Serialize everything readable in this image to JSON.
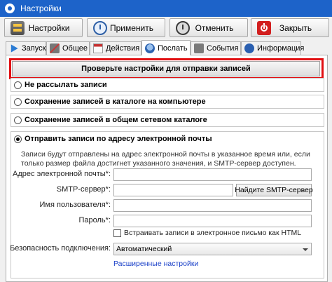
{
  "window": {
    "title": "Настройки"
  },
  "toolbar": {
    "settings_label": "Настройки",
    "apply_label": "Применить",
    "cancel_label": "Отменить",
    "close_label": "Закрыть"
  },
  "tabs": [
    {
      "label": "Запуск",
      "icon": "play-icon"
    },
    {
      "label": "Общее",
      "icon": "tools-icon"
    },
    {
      "label": "Действия",
      "icon": "calendar-icon"
    },
    {
      "label": "Послать",
      "icon": "send-icon",
      "active": true
    },
    {
      "label": "События",
      "icon": "events-icon"
    },
    {
      "label": "Информация",
      "icon": "info-icon"
    }
  ],
  "panel": {
    "check_button": "Проверьте настройки для отправки записей",
    "options": [
      {
        "label": "Не рассылать записи",
        "checked": false
      },
      {
        "label": "Сохранение записей в каталоге на компьютере",
        "checked": false
      },
      {
        "label": "Сохранение записей в общем сетевом каталоге",
        "checked": false
      },
      {
        "label": "Отправить записи по адресу электронной почты",
        "checked": true
      }
    ],
    "description": "Записи будут отправлены на адрес электронной почты в указанное время или, если только размер файла достигнет указанного значения, и SMTP-сервер доступен.",
    "fields": {
      "email_label": "Адрес электронной почты*:",
      "smtp_label": "SMTP-сервер*:",
      "username_label": "Имя пользователя*:",
      "password_label": "Пароль*:",
      "find_smtp_button": "Найдите SMTP-сервер",
      "embed_html_label": "Встраивать записи в электронное письмо как HTML",
      "security_label": "Безопасность подключения:",
      "security_value": "Автоматический",
      "advanced_link": "Расширенные настройки"
    }
  },
  "colors": {
    "title_bar": "#1d63c9",
    "highlight": "#e10f12",
    "link": "#1a40c8"
  }
}
